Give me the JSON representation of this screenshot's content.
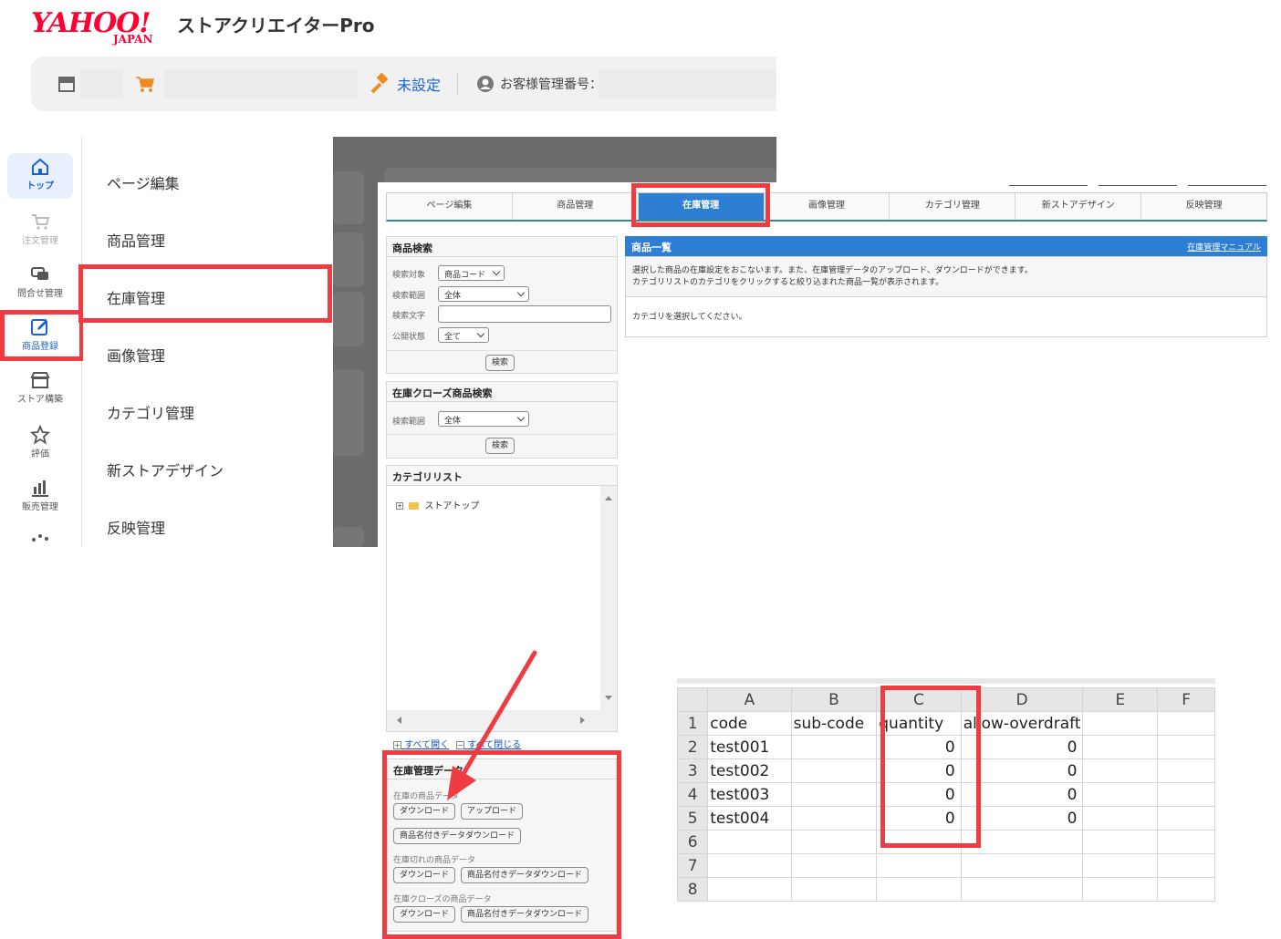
{
  "header": {
    "logo_main": "YAHOO!",
    "logo_sub": "JAPAN",
    "app_title": "ストアクリエイターPro",
    "unset_label": "未設定",
    "customer_label": "お客様管理番号："
  },
  "leftnav": {
    "items": [
      {
        "label": "トップ",
        "icon": "home-icon"
      },
      {
        "label": "注文管理",
        "icon": "cart-icon"
      },
      {
        "label": "問合せ管理",
        "icon": "chat-icon"
      },
      {
        "label": "商品登録",
        "icon": "edit-icon"
      },
      {
        "label": "ストア構築",
        "icon": "store-icon"
      },
      {
        "label": "評価",
        "icon": "star-icon"
      },
      {
        "label": "販売管理",
        "icon": "bar-chart-icon"
      }
    ]
  },
  "submenu": {
    "items": [
      "ページ編集",
      "商品管理",
      "在庫管理",
      "画像管理",
      "カテゴリ管理",
      "新ストアデザイン",
      "反映管理"
    ]
  },
  "tabs": [
    "ページ編集",
    "商品管理",
    "在庫管理",
    "画像管理",
    "カテゴリ管理",
    "新ストアデザイン",
    "反映管理"
  ],
  "search_panel": {
    "title": "商品検索",
    "target_label": "検索対象",
    "target_value": "商品コード",
    "range_label": "検索範囲",
    "range_value": "全体",
    "text_label": "検索文字",
    "text_value": "",
    "status_label": "公開状態",
    "status_value": "全て",
    "search_button": "検索"
  },
  "closed_panel": {
    "title": "在庫クローズ商品検索",
    "range_label": "検索範囲",
    "range_value": "全体",
    "search_button": "検索"
  },
  "category_panel": {
    "title": "カテゴリリスト",
    "node": "ストアトップ",
    "expand_all": "すべて開く",
    "collapse_all": "すべて閉じる"
  },
  "data_panel": {
    "title": "在庫管理データ",
    "groups": [
      {
        "label": "在庫の商品データ",
        "buttons": [
          "ダウンロード",
          "アップロード",
          "商品名付きデータダウンロード"
        ]
      },
      {
        "label": "在庫切れの商品データ",
        "buttons": [
          "ダウンロード",
          "商品名付きデータダウンロード"
        ]
      },
      {
        "label": "在庫クローズの商品データ",
        "buttons": [
          "ダウンロード",
          "商品名付きデータダウンロード"
        ]
      }
    ]
  },
  "product_list": {
    "title": "商品一覧",
    "manual_link": "在庫管理マニュアル",
    "desc_line1": "選択した商品の在庫設定をおこないます。また、在庫管理データのアップロード、ダウンロードができます。",
    "desc_line2": "カテゴリリストのカテゴリをクリックすると絞り込まれた商品一覧が表示されます。",
    "empty_message": "カテゴリを選択してください。"
  },
  "spreadsheet": {
    "columns": [
      "A",
      "B",
      "C",
      "D",
      "E",
      "F"
    ],
    "rows": [
      {
        "n": "1",
        "cells": [
          "code",
          "sub-code",
          "quantity",
          "allow-overdraft",
          "",
          ""
        ]
      },
      {
        "n": "2",
        "cells": [
          "test001",
          "",
          "0",
          "0",
          "",
          ""
        ]
      },
      {
        "n": "3",
        "cells": [
          "test002",
          "",
          "0",
          "0",
          "",
          ""
        ]
      },
      {
        "n": "4",
        "cells": [
          "test003",
          "",
          "0",
          "0",
          "",
          ""
        ]
      },
      {
        "n": "5",
        "cells": [
          "test004",
          "",
          "0",
          "0",
          "",
          ""
        ]
      },
      {
        "n": "6",
        "cells": [
          "",
          "",
          "",
          "",
          "",
          ""
        ]
      },
      {
        "n": "7",
        "cells": [
          "",
          "",
          "",
          "",
          "",
          ""
        ]
      },
      {
        "n": "8",
        "cells": [
          "",
          "",
          "",
          "",
          "",
          ""
        ]
      }
    ]
  },
  "colors": {
    "highlight": "#ef3b42",
    "accent_blue": "#2d7fd3",
    "yahoo_red": "#ff0033"
  }
}
